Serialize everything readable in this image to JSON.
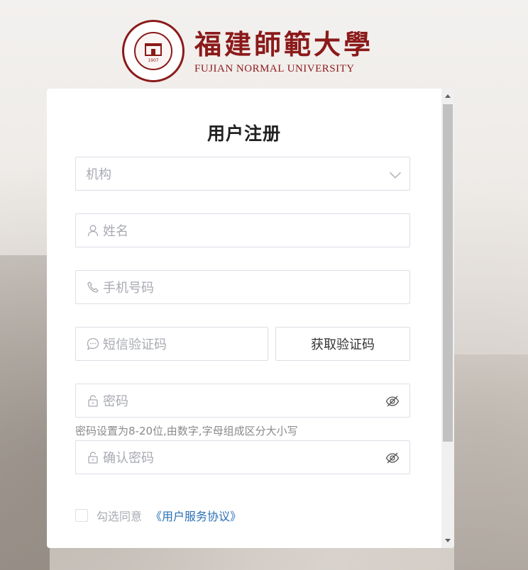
{
  "header": {
    "university_name_cn": "福建師範大學",
    "university_name_en": "FUJIAN NORMAL UNIVERSITY",
    "logo_seal_text": "1907"
  },
  "form": {
    "title": "用户注册",
    "institution": {
      "placeholder": "机构",
      "icon": "chevron-down-icon"
    },
    "name": {
      "placeholder": "姓名",
      "icon": "user-icon"
    },
    "phone": {
      "placeholder": "手机号码",
      "icon": "phone-icon"
    },
    "sms_code": {
      "placeholder": "短信验证码",
      "icon": "chat-bubble-icon"
    },
    "get_code_button": "获取验证码",
    "password": {
      "placeholder": "密码",
      "icon": "lock-icon",
      "toggle_icon": "eye-off-icon"
    },
    "password_hint": "密码设置为8-20位,由数字,字母组成区分大小写",
    "confirm_password": {
      "placeholder": "确认密码",
      "icon": "lock-icon",
      "toggle_icon": "eye-off-icon"
    },
    "agree_label": "勾选同意",
    "agreement_link": "《用户服务协议》",
    "agree_checked": false
  },
  "colors": {
    "brand": "#8b1a1a",
    "link": "#2a6fb4",
    "placeholder": "#a8abb2",
    "border": "#dcdfe6"
  }
}
